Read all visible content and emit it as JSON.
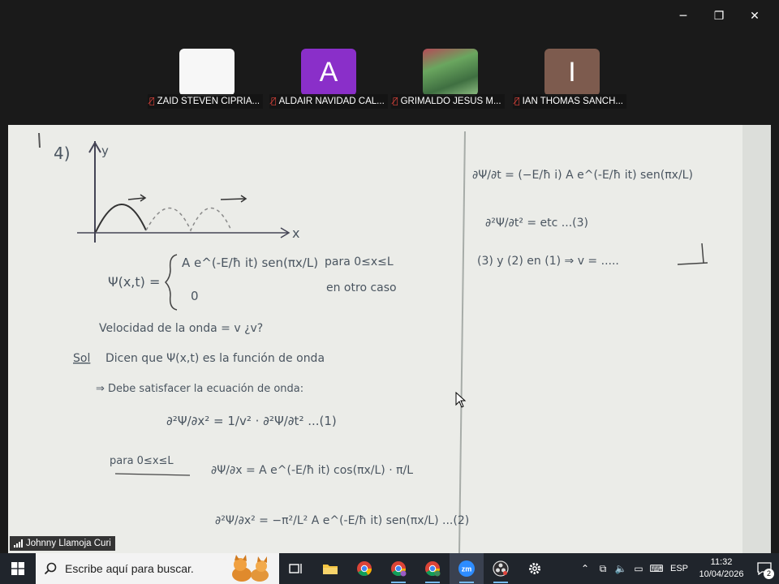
{
  "window_controls": {
    "minimize": "─",
    "restore": "❐",
    "close": "✕"
  },
  "participants": [
    {
      "name": "ZAID STEVEN CIPRIA...",
      "initial": "",
      "tile_color": "#f7f7f7",
      "muted": true
    },
    {
      "name": "ALDAIR NAVIDAD CAL...",
      "initial": "A",
      "tile_color": "#8a2fc9",
      "muted": true
    },
    {
      "name": "GRIMALDO JESUS M...",
      "initial": "",
      "tile_color": "#5f8f54",
      "muted": true
    },
    {
      "name": "IAN THOMAS SANCH...",
      "initial": "I",
      "tile_color": "#7d5b4e",
      "muted": true
    }
  ],
  "speaker": {
    "name": "Johnny Llamoja Curi"
  },
  "whiteboard": {
    "problem_number": "4)",
    "axis_y": "y",
    "axis_x": "x",
    "psi_lhs": "Ψ(x,t) =",
    "psi_case1": "A e^(-E/ħ it) sen(πx/L)",
    "psi_case1_cond": "para 0≤x≤L",
    "psi_case2": "0",
    "psi_case2_cond": "en otro caso",
    "question": "Velocidad de la onda = v   ¿v?",
    "sol_label": "Sol",
    "sol_line1": "Dicen que Ψ(x,t) es la función de onda",
    "sol_line2": "⇒ Debe satisfacer la ecuación de onda:",
    "wave_eq": "∂²Ψ/∂x² = 1/v² · ∂²Ψ/∂t²  ...(1)",
    "para_label": "para 0≤x≤L",
    "deriv1": "∂Ψ/∂x = A e^(-E/ħ it) cos(πx/L) · π/L",
    "deriv2": "∂²Ψ/∂x² = −π²/L² A e^(-E/ħ it) sen(πx/L)  ...(2)",
    "rt1": "∂Ψ/∂t = (−E/ħ i) A e^(-E/ħ it) sen(πx/L)",
    "rt2": "∂²Ψ/∂t² = etc  ...(3)",
    "rt3": "(3) y (2) en (1) ⇒ v = ....."
  },
  "taskbar": {
    "search_placeholder": "Escribe aquí para buscar.",
    "apps": [
      "task-view",
      "file-explorer",
      "chrome",
      "chrome-profile-2",
      "chrome-profile-3",
      "zoom",
      "obs",
      "settings"
    ],
    "language": "ESP",
    "time": "11:32",
    "date": "10/04/2026",
    "notifications": "2"
  }
}
